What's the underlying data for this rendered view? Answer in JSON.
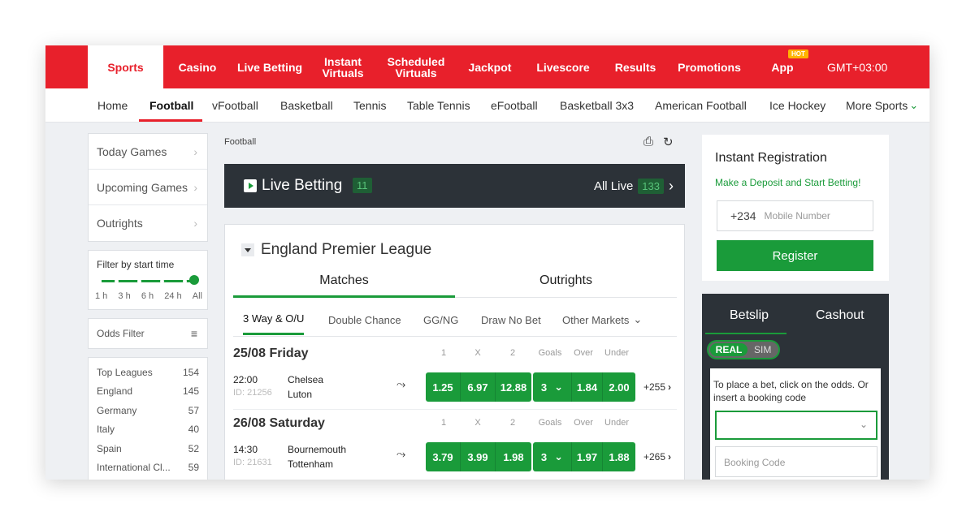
{
  "topnav": {
    "items": [
      {
        "label": "Sports",
        "active": true
      },
      {
        "label": "Casino"
      },
      {
        "label": "Live Betting"
      },
      {
        "label": "Instant Virtuals"
      },
      {
        "label": "Scheduled Virtuals"
      },
      {
        "label": "Jackpot"
      },
      {
        "label": "Livescore"
      },
      {
        "label": "Results"
      },
      {
        "label": "Promotions"
      },
      {
        "label": "App"
      }
    ],
    "hot_badge": "HOT",
    "timezone": "GMT+03:00"
  },
  "subnav": {
    "items": [
      "Home",
      "Football",
      "vFootball",
      "Basketball",
      "Tennis",
      "Table Tennis",
      "eFootball",
      "Basketball 3x3",
      "American Football",
      "Ice Hockey",
      "More Sports"
    ],
    "active": "Football"
  },
  "sidebar": {
    "menu": [
      "Today Games",
      "Upcoming Games",
      "Outrights"
    ],
    "filter_title": "Filter by start time",
    "filter_labels": [
      "1 h",
      "3 h",
      "6 h",
      "24 h",
      "All"
    ],
    "filter_selected": "All",
    "odds_filter": "Odds Filter",
    "leagues": [
      {
        "name": "Top Leagues",
        "count": "154"
      },
      {
        "name": "England",
        "count": "145"
      },
      {
        "name": "Germany",
        "count": "57"
      },
      {
        "name": "Italy",
        "count": "40"
      },
      {
        "name": "Spain",
        "count": "52"
      },
      {
        "name": "International Cl...",
        "count": "59"
      }
    ]
  },
  "main": {
    "breadcrumb": "Football",
    "live_title": "Live Betting",
    "live_count": "11",
    "all_live_label": "All Live",
    "all_live_count": "133",
    "league_name": "England Premier League",
    "tabs": [
      "Matches",
      "Outrights"
    ],
    "markets": [
      "3 Way & O/U",
      "Double Chance",
      "GG/NG",
      "Draw No Bet",
      "Other Markets"
    ],
    "col_headers": [
      "1",
      "X",
      "2",
      "Goals",
      "Over",
      "Under"
    ],
    "days": [
      {
        "label": "25/08 Friday",
        "matches": [
          {
            "time": "22:00",
            "id": "ID: 21256",
            "home": "Chelsea",
            "away": "Luton",
            "odds": [
              "1.25",
              "6.97",
              "12.88"
            ],
            "goals": "3",
            "over": "1.84",
            "under": "2.00",
            "more": "+255"
          }
        ]
      },
      {
        "label": "26/08 Saturday",
        "matches": [
          {
            "time": "14:30",
            "id": "ID: 21631",
            "home": "Bournemouth",
            "away": "Tottenham",
            "odds": [
              "3.79",
              "3.99",
              "1.98"
            ],
            "goals": "3",
            "over": "1.97",
            "under": "1.88",
            "more": "+265"
          }
        ]
      }
    ]
  },
  "registration": {
    "title": "Instant Registration",
    "subtitle": "Make a Deposit and Start Betting!",
    "country_code": "+234",
    "phone_placeholder": "Mobile Number",
    "button": "Register"
  },
  "betslip": {
    "tabs": [
      "Betslip",
      "Cashout"
    ],
    "toggle_real": "REAL",
    "toggle_sim": "SIM",
    "hint": "To place a bet, click on the odds. Or insert a booking code",
    "booking_placeholder": "Booking Code"
  },
  "colors": {
    "brand_red": "#e8202b",
    "accent_green": "#1a9b3a",
    "dark": "#2c3238"
  }
}
